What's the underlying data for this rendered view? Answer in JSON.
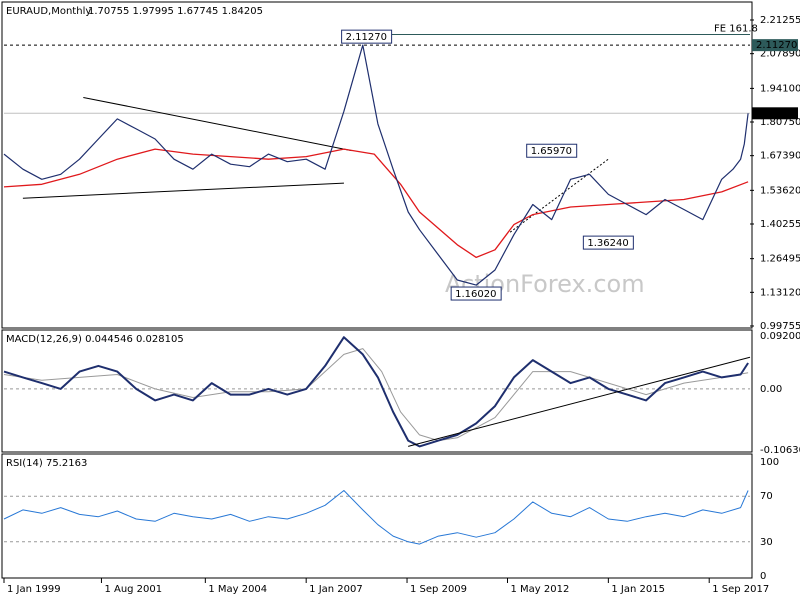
{
  "chart_data": {
    "type": "line",
    "symbol": "EURAUD,Monthly",
    "ohlc": "1.70755 1.97995 1.67745 1.84205",
    "watermark": "ActionForex.com",
    "colors": {
      "price": "#1f2f6e",
      "sma": "#e0191c",
      "macd": "#1f2f6e",
      "signal": "#9a9a9a",
      "rsi": "#2878d6",
      "trendline": "#000000",
      "fe_line": "#2d5a5a",
      "label_border": "#1f2f6e",
      "current_box": "#000000"
    },
    "x_ticks": [
      "1 Jan 1999",
      "1 Aug 2001",
      "1 May 2004",
      "1 Jan 2007",
      "1 Sep 2009",
      "1 May 2012",
      "1 Jan 2015",
      "1 Sep 2017"
    ],
    "x_tick_years": [
      1999.0,
      2001.58,
      2004.33,
      2007.0,
      2009.67,
      2012.33,
      2015.0,
      2017.67
    ],
    "x_range": [
      1999.0,
      2018.75
    ],
    "price_panel": {
      "ylim": [
        0.99755,
        2.21255
      ],
      "y_ticks": [
        "2.21255",
        "2.07890",
        "1.94100",
        "1.80750",
        "1.67390",
        "1.53620",
        "1.40255",
        "1.26495",
        "1.13120",
        "0.99755"
      ],
      "y_tick_values": [
        2.21255,
        2.0789,
        1.941,
        1.8075,
        1.6739,
        1.5362,
        1.40255,
        1.26495,
        1.1312,
        0.99755
      ],
      "series": [
        {
          "name": "EURAUD",
          "x": [
            1999.0,
            1999.5,
            2000.0,
            2000.5,
            2001.0,
            2001.5,
            2002.0,
            2002.5,
            2003.0,
            2003.5,
            2004.0,
            2004.5,
            2005.0,
            2005.5,
            2006.0,
            2006.5,
            2007.0,
            2007.5,
            2008.0,
            2008.5,
            2008.9,
            2009.3,
            2009.7,
            2010.0,
            2010.5,
            2011.0,
            2011.5,
            2012.0,
            2012.5,
            2013.0,
            2013.5,
            2014.0,
            2014.5,
            2015.0,
            2015.5,
            2016.0,
            2016.5,
            2017.0,
            2017.5,
            2018.0,
            2018.3,
            2018.5,
            2018.6,
            2018.7
          ],
          "y": [
            1.68,
            1.62,
            1.58,
            1.6,
            1.66,
            1.74,
            1.82,
            1.78,
            1.74,
            1.66,
            1.62,
            1.68,
            1.64,
            1.63,
            1.68,
            1.65,
            1.66,
            1.62,
            1.85,
            2.1127,
            1.8,
            1.62,
            1.45,
            1.38,
            1.28,
            1.18,
            1.16,
            1.22,
            1.36,
            1.48,
            1.42,
            1.58,
            1.6,
            1.52,
            1.48,
            1.44,
            1.5,
            1.46,
            1.42,
            1.58,
            1.62,
            1.66,
            1.72,
            1.84205
          ]
        },
        {
          "name": "SMA",
          "x": [
            1999.0,
            2000.0,
            2001.0,
            2002.0,
            2003.0,
            2004.0,
            2005.0,
            2006.0,
            2007.0,
            2008.0,
            2008.8,
            2009.5,
            2010.0,
            2011.0,
            2011.5,
            2012.0,
            2012.5,
            2013.0,
            2014.0,
            2015.0,
            2016.0,
            2017.0,
            2018.0,
            2018.7
          ],
          "y": [
            1.55,
            1.56,
            1.6,
            1.66,
            1.7,
            1.68,
            1.67,
            1.66,
            1.67,
            1.7,
            1.68,
            1.56,
            1.45,
            1.32,
            1.27,
            1.3,
            1.4,
            1.44,
            1.47,
            1.48,
            1.49,
            1.5,
            1.53,
            1.57
          ]
        }
      ],
      "annotations": [
        {
          "text": "2.11270",
          "x": 2008.6,
          "y": 2.1127
        },
        {
          "text": "1.65970",
          "x": 2013.5,
          "y": 1.6597
        },
        {
          "text": "1.36240",
          "x": 2015.0,
          "y": 1.3624
        },
        {
          "text": "1.16020",
          "x": 2011.5,
          "y": 1.1602
        }
      ],
      "fe_level": {
        "label": "FE 161.8",
        "y": 2.155
      },
      "hline_label": "2.11270",
      "current_value": "1.84205"
    },
    "macd_panel": {
      "label": "MACD(12,26,9) 0.044546 0.028105",
      "ylim": [
        -0.106308,
        0.092004
      ],
      "y_ticks": [
        "0.092004",
        "0.00",
        "-0.106308"
      ],
      "y_tick_values": [
        0.092004,
        0.0,
        -0.106308
      ],
      "macd": {
        "x": [
          1999.0,
          1999.5,
          2000.0,
          2000.5,
          2001.0,
          2001.5,
          2002.0,
          2002.5,
          2003.0,
          2003.5,
          2004.0,
          2004.5,
          2005.0,
          2005.5,
          2006.0,
          2006.5,
          2007.0,
          2007.5,
          2008.0,
          2008.5,
          2008.9,
          2009.3,
          2009.7,
          2010.0,
          2010.5,
          2011.0,
          2011.5,
          2012.0,
          2012.5,
          2013.0,
          2013.5,
          2014.0,
          2014.5,
          2015.0,
          2015.5,
          2016.0,
          2016.5,
          2017.0,
          2017.5,
          2018.0,
          2018.5,
          2018.7
        ],
        "y": [
          0.03,
          0.02,
          0.01,
          0.0,
          0.03,
          0.04,
          0.03,
          0.0,
          -0.02,
          -0.01,
          -0.02,
          0.01,
          -0.01,
          -0.01,
          0.0,
          -0.01,
          0.0,
          0.04,
          0.09,
          0.06,
          0.02,
          -0.04,
          -0.09,
          -0.1,
          -0.09,
          -0.08,
          -0.06,
          -0.03,
          0.02,
          0.05,
          0.03,
          0.01,
          0.02,
          0.0,
          -0.01,
          -0.02,
          0.01,
          0.02,
          0.03,
          0.02,
          0.025,
          0.045
        ]
      },
      "signal": {
        "x": [
          1999.0,
          2000.0,
          2001.0,
          2002.0,
          2003.0,
          2004.0,
          2005.0,
          2006.0,
          2007.0,
          2008.0,
          2008.5,
          2009.0,
          2009.5,
          2010.0,
          2010.5,
          2011.0,
          2012.0,
          2013.0,
          2014.0,
          2015.0,
          2016.0,
          2017.0,
          2018.0,
          2018.7
        ],
        "y": [
          0.025,
          0.015,
          0.02,
          0.025,
          0.0,
          -0.015,
          -0.005,
          -0.005,
          0.0,
          0.06,
          0.07,
          0.03,
          -0.04,
          -0.08,
          -0.09,
          -0.085,
          -0.05,
          0.03,
          0.03,
          0.01,
          -0.01,
          0.01,
          0.02,
          0.028
        ]
      },
      "trendline": {
        "x": [
          2009.7,
          2018.75
        ],
        "y": [
          -0.1,
          0.055
        ]
      }
    },
    "rsi_panel": {
      "label": "RSI(14) 75.2163",
      "ylim": [
        0,
        100
      ],
      "y_ticks": [
        "100",
        "70",
        "30",
        "0"
      ],
      "y_tick_values": [
        100,
        70,
        30,
        0
      ],
      "rsi": {
        "x": [
          1999.0,
          1999.5,
          2000.0,
          2000.5,
          2001.0,
          2001.5,
          2002.0,
          2002.5,
          2003.0,
          2003.5,
          2004.0,
          2004.5,
          2005.0,
          2005.5,
          2006.0,
          2006.5,
          2007.0,
          2007.5,
          2008.0,
          2008.5,
          2008.9,
          2009.3,
          2009.7,
          2010.0,
          2010.5,
          2011.0,
          2011.5,
          2012.0,
          2012.5,
          2013.0,
          2013.5,
          2014.0,
          2014.5,
          2015.0,
          2015.5,
          2016.0,
          2016.5,
          2017.0,
          2017.5,
          2018.0,
          2018.5,
          2018.7
        ],
        "y": [
          50,
          58,
          55,
          60,
          54,
          52,
          57,
          50,
          48,
          55,
          52,
          50,
          54,
          48,
          52,
          50,
          55,
          62,
          75,
          58,
          45,
          35,
          30,
          28,
          35,
          38,
          34,
          38,
          50,
          65,
          55,
          52,
          60,
          50,
          48,
          52,
          55,
          52,
          58,
          55,
          60,
          75
        ]
      }
    }
  }
}
